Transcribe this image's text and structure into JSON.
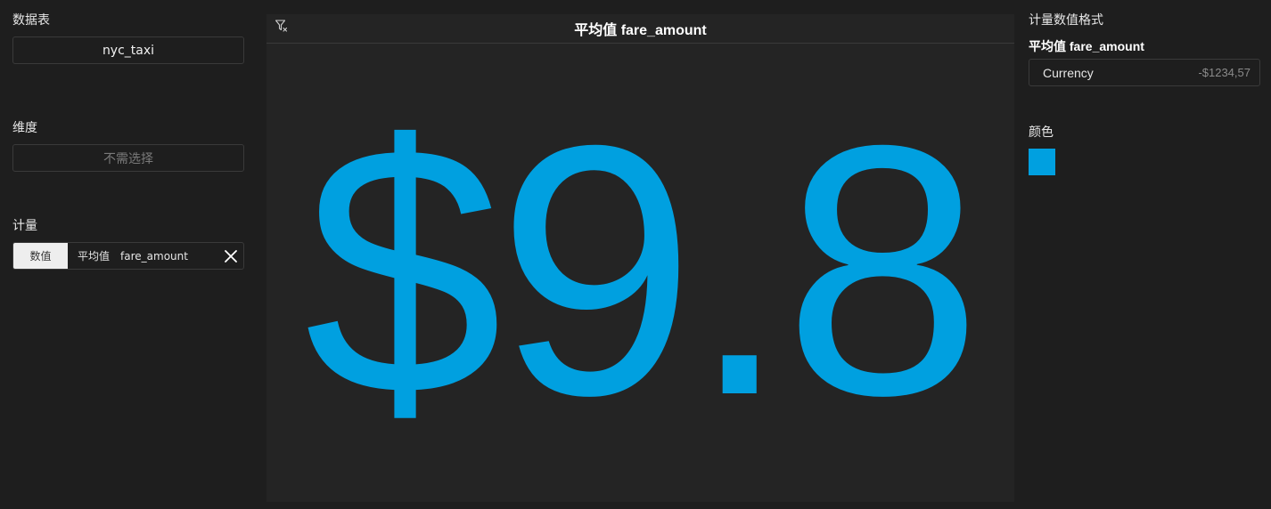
{
  "left": {
    "datasource_label": "数据表",
    "datasource_value": "nyc_taxi",
    "dimension_label": "维度",
    "dimension_placeholder": "不需选择",
    "measure_label": "计量",
    "measure": {
      "type": "数值",
      "aggregation": "平均值",
      "field": "fare_amount",
      "remove_icon": "close-icon"
    }
  },
  "center": {
    "title": "平均值 fare_amount",
    "filter_icon": "filter-clear-icon",
    "value": "$9.8"
  },
  "right": {
    "format_label": "计量数值格式",
    "measure_name": "平均值 fare_amount",
    "format_name": "Currency",
    "format_example": "-$1234,57",
    "color_label": "颜色",
    "color": "#00a0e0"
  }
}
